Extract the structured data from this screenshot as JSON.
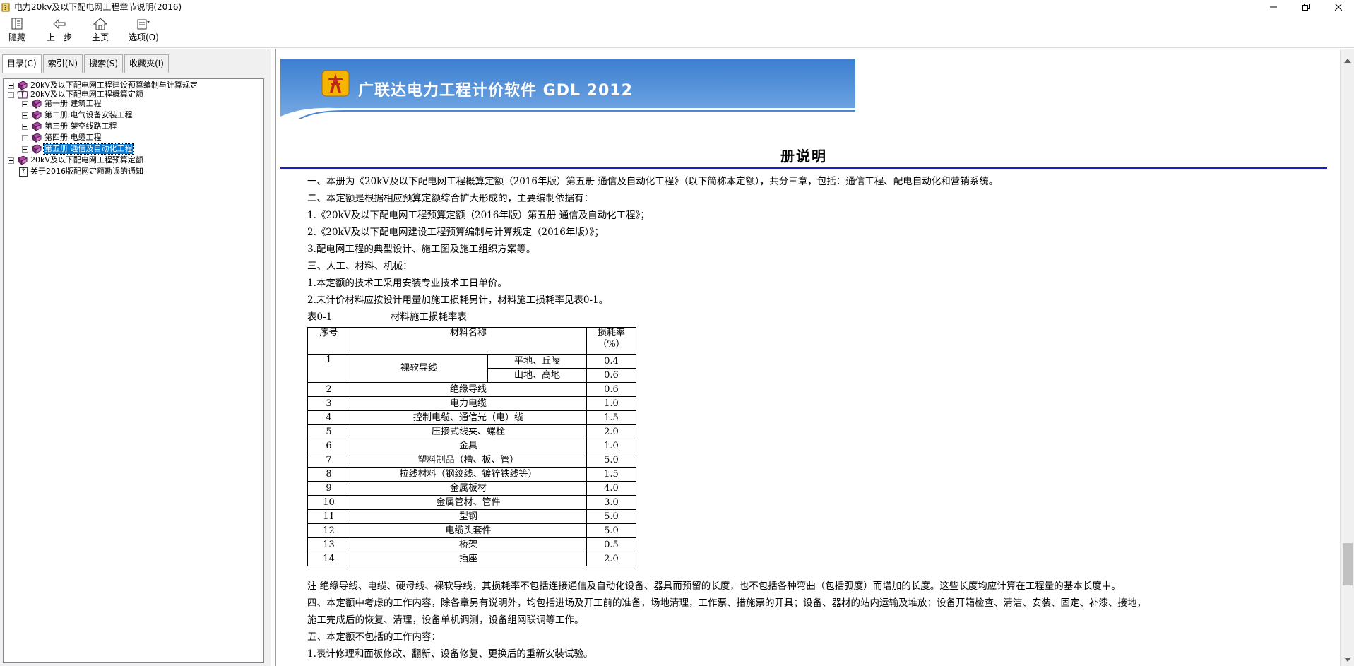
{
  "window": {
    "title": "电力20kv及以下配电网工程章节说明(2016)"
  },
  "toolbar": {
    "hide_label": "隐藏",
    "back_label": "上一步",
    "home_label": "主页",
    "options_label": "选项(O)"
  },
  "tabs": {
    "contents": "目录(C)",
    "index": "索引(N)",
    "search": "搜索(S)",
    "favorites": "收藏夹(I)"
  },
  "tree": {
    "items": [
      {
        "label": "20kV及以下配电网工程建设预算编制与计算规定"
      },
      {
        "label": "20kV及以下配电网工程概算定额"
      },
      {
        "label": "第一册 建筑工程"
      },
      {
        "label": "第二册 电气设备安装工程"
      },
      {
        "label": "第三册 架空线路工程"
      },
      {
        "label": "第四册 电缆工程"
      },
      {
        "label": "第五册 通信及自动化工程"
      },
      {
        "label": "20kV及以下配电网工程预算定额"
      },
      {
        "label": "关于2016版配网定额勘误的通知"
      }
    ]
  },
  "banner": {
    "text": "广联达电力工程计价软件 GDL 2012"
  },
  "doc": {
    "title": "册说明",
    "p1": "一、本册为《20kV及以下配电网工程概算定额（2016年版）第五册 通信及自动化工程》（以下简称本定额），共分三章，包括：通信工程、配电自动化和营销系统。",
    "p2": "二、本定额是根据相应预算定额综合扩大形成的，主要编制依据有：",
    "p3": "1.《20kV及以下配电网工程预算定额（2016年版）第五册 通信及自动化工程》；",
    "p4": "2.《20kV及以下配电网建设工程预算编制与计算规定（2016年版）》；",
    "p5": "3.配电网工程的典型设计、施工图及施工组织方案等。",
    "p6": "三、人工、材料、机械：",
    "p7": "1.本定额的技术工采用安装专业技术工日单价。",
    "p8": "2.未计价材料应按设计用量加施工损耗另计，材料施工损耗率见表0-1。",
    "table_caption_id": "表0-1",
    "table_caption": "材料施工损耗率表",
    "note": "注 绝缘导线、电缆、硬母线、裸软导线，其损耗率不包括连接通信及自动化设备、器具而预留的长度，也不包括各种弯曲（包括弧度）而增加的长度。这些长度均应计算在工程量的基本长度中。",
    "p9": "四、本定额中考虑的工作内容，除各章另有说明外，均包括进场及开工前的准备，场地清理，工作票、措施票的开具；设备、器材的站内运输及堆放；设备开箱检查、清洁、安装、固定、补漆、接地，",
    "p10": "施工完成后的恢复、清理，设备单机调测，设备组网联调等工作。",
    "p11": "五、本定额不包括的工作内容：",
    "p12": "1.表计修理和面板修改、翻新、设备修复、更换后的重新安装试验。"
  },
  "table": {
    "headers": {
      "no": "序号",
      "name": "材料名称",
      "rate_line1": "损耗率",
      "rate_line2": "（%）"
    },
    "row1": {
      "no": "1",
      "name": "裸软导线",
      "sub1": "平地、丘陵",
      "rate1": "0.4",
      "sub2": "山地、高地",
      "rate2": "0.6"
    },
    "rows": [
      {
        "no": "2",
        "name": "绝缘导线",
        "rate": "0.6"
      },
      {
        "no": "3",
        "name": "电力电缆",
        "rate": "1.0"
      },
      {
        "no": "4",
        "name": "控制电缆、通信光（电）缆",
        "rate": "1.5"
      },
      {
        "no": "5",
        "name": "压接式线夹、螺栓",
        "rate": "2.0"
      },
      {
        "no": "6",
        "name": "金具",
        "rate": "1.0"
      },
      {
        "no": "7",
        "name": "塑料制品（槽、板、管）",
        "rate": "5.0"
      },
      {
        "no": "8",
        "name": "拉线材料（钢绞线、镀锌铁线等）",
        "rate": "1.5"
      },
      {
        "no": "9",
        "name": "金属板材",
        "rate": "4.0"
      },
      {
        "no": "10",
        "name": "金属管材、管件",
        "rate": "3.0"
      },
      {
        "no": "11",
        "name": "型钢",
        "rate": "5.0"
      },
      {
        "no": "12",
        "name": "电缆头套件",
        "rate": "5.0"
      },
      {
        "no": "13",
        "name": "桥架",
        "rate": "0.5"
      },
      {
        "no": "14",
        "name": "插座",
        "rate": "2.0"
      }
    ]
  }
}
